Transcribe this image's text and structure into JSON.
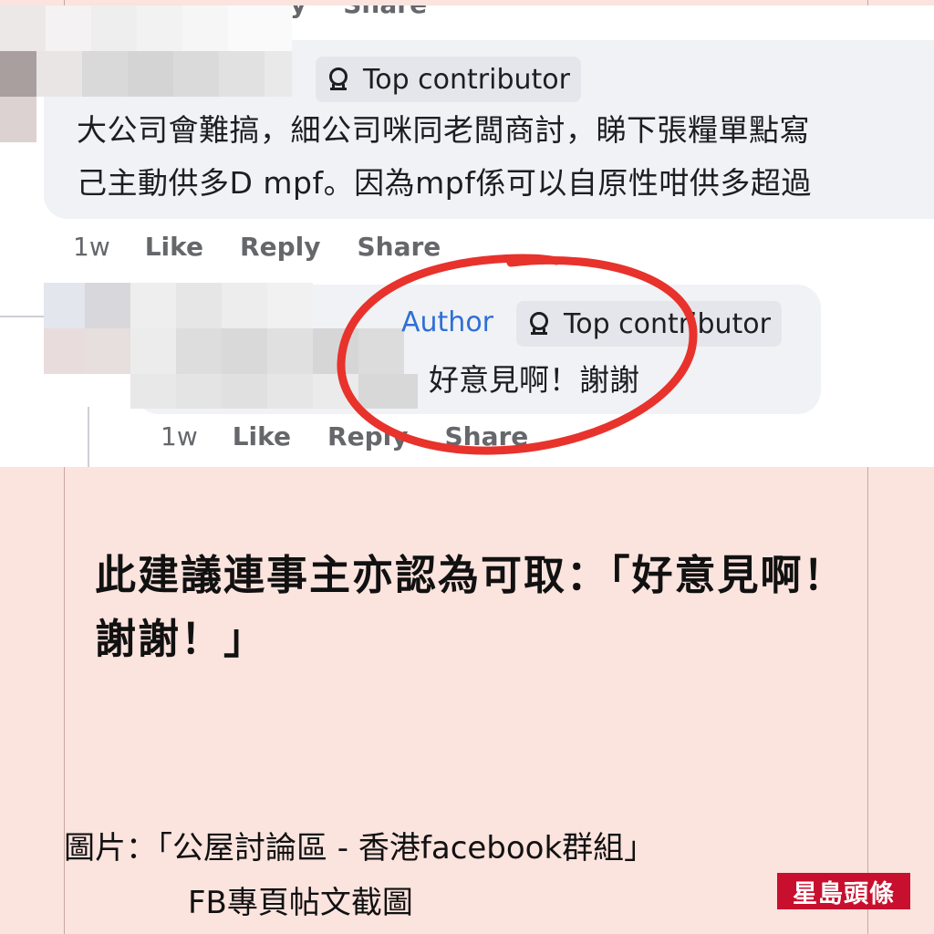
{
  "comment1": {
    "badge": "Top contributor",
    "lines": [
      "大公司會難搞，細公司咪同老闆商討，睇下張糧單點寫",
      "己主動供多D mpf。因為mpf係可以自原性咁供多超過"
    ],
    "actions": {
      "time": "1w",
      "like": "Like",
      "reply": "Reply",
      "share": "Share"
    }
  },
  "top_actions_partial": {
    "reply": "y",
    "share": "Share"
  },
  "reply": {
    "author_label": "Author",
    "badge": "Top contributor",
    "text": "好意見啊！謝謝",
    "actions": {
      "time": "1w",
      "like": "Like",
      "reply": "Reply",
      "share": "Share"
    }
  },
  "caption": "此建議連事主亦認為可取：「好意見啊！謝謝！」",
  "source": {
    "line1": "圖片：「公屋討論區 - 香港facebook群組」",
    "line2": "FB專頁帖文截圖"
  },
  "logo": {
    "text": "星島頭條"
  },
  "colors": {
    "background": "#fbe3de",
    "author_blue": "#2f6fd6",
    "highlight_red": "#e8322c",
    "bubble": "#f0f2f5"
  }
}
